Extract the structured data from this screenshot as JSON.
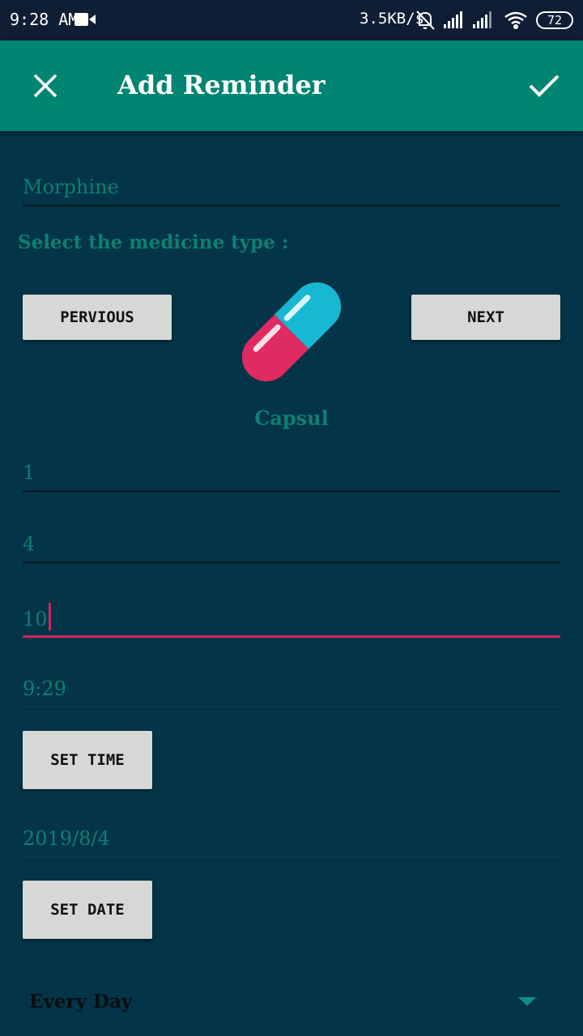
{
  "status_bar": {
    "time": "9:28 AM",
    "speed": "3.5KB/s",
    "battery": "72",
    "icons": [
      "video-camera-icon",
      "mute-bell-icon",
      "signal-icon",
      "signal-icon",
      "wifi-icon",
      "battery-icon"
    ]
  },
  "app_bar": {
    "title": "Add Reminder",
    "close_icon": "close-icon",
    "confirm_icon": "check-icon"
  },
  "form": {
    "medicine_name": "Morphine",
    "type_label": "Select the medicine type :",
    "previous_label": "PERVIOUS",
    "next_label": "NEXT",
    "medicine_type": "Capsul",
    "field_1": "1",
    "field_2": "4",
    "field_3": "10",
    "time_value": "9:29",
    "set_time_label": "SET TIME",
    "date_value": "2019/8/4",
    "set_date_label": "SET DATE",
    "repeat_value": "Every Day"
  },
  "colors": {
    "background": "#033447",
    "app_bar": "#008573",
    "status_bar": "#0f1e34",
    "accent": "#d1245f",
    "text_teal": "#0e7f72",
    "button": "#d6d8d6"
  }
}
